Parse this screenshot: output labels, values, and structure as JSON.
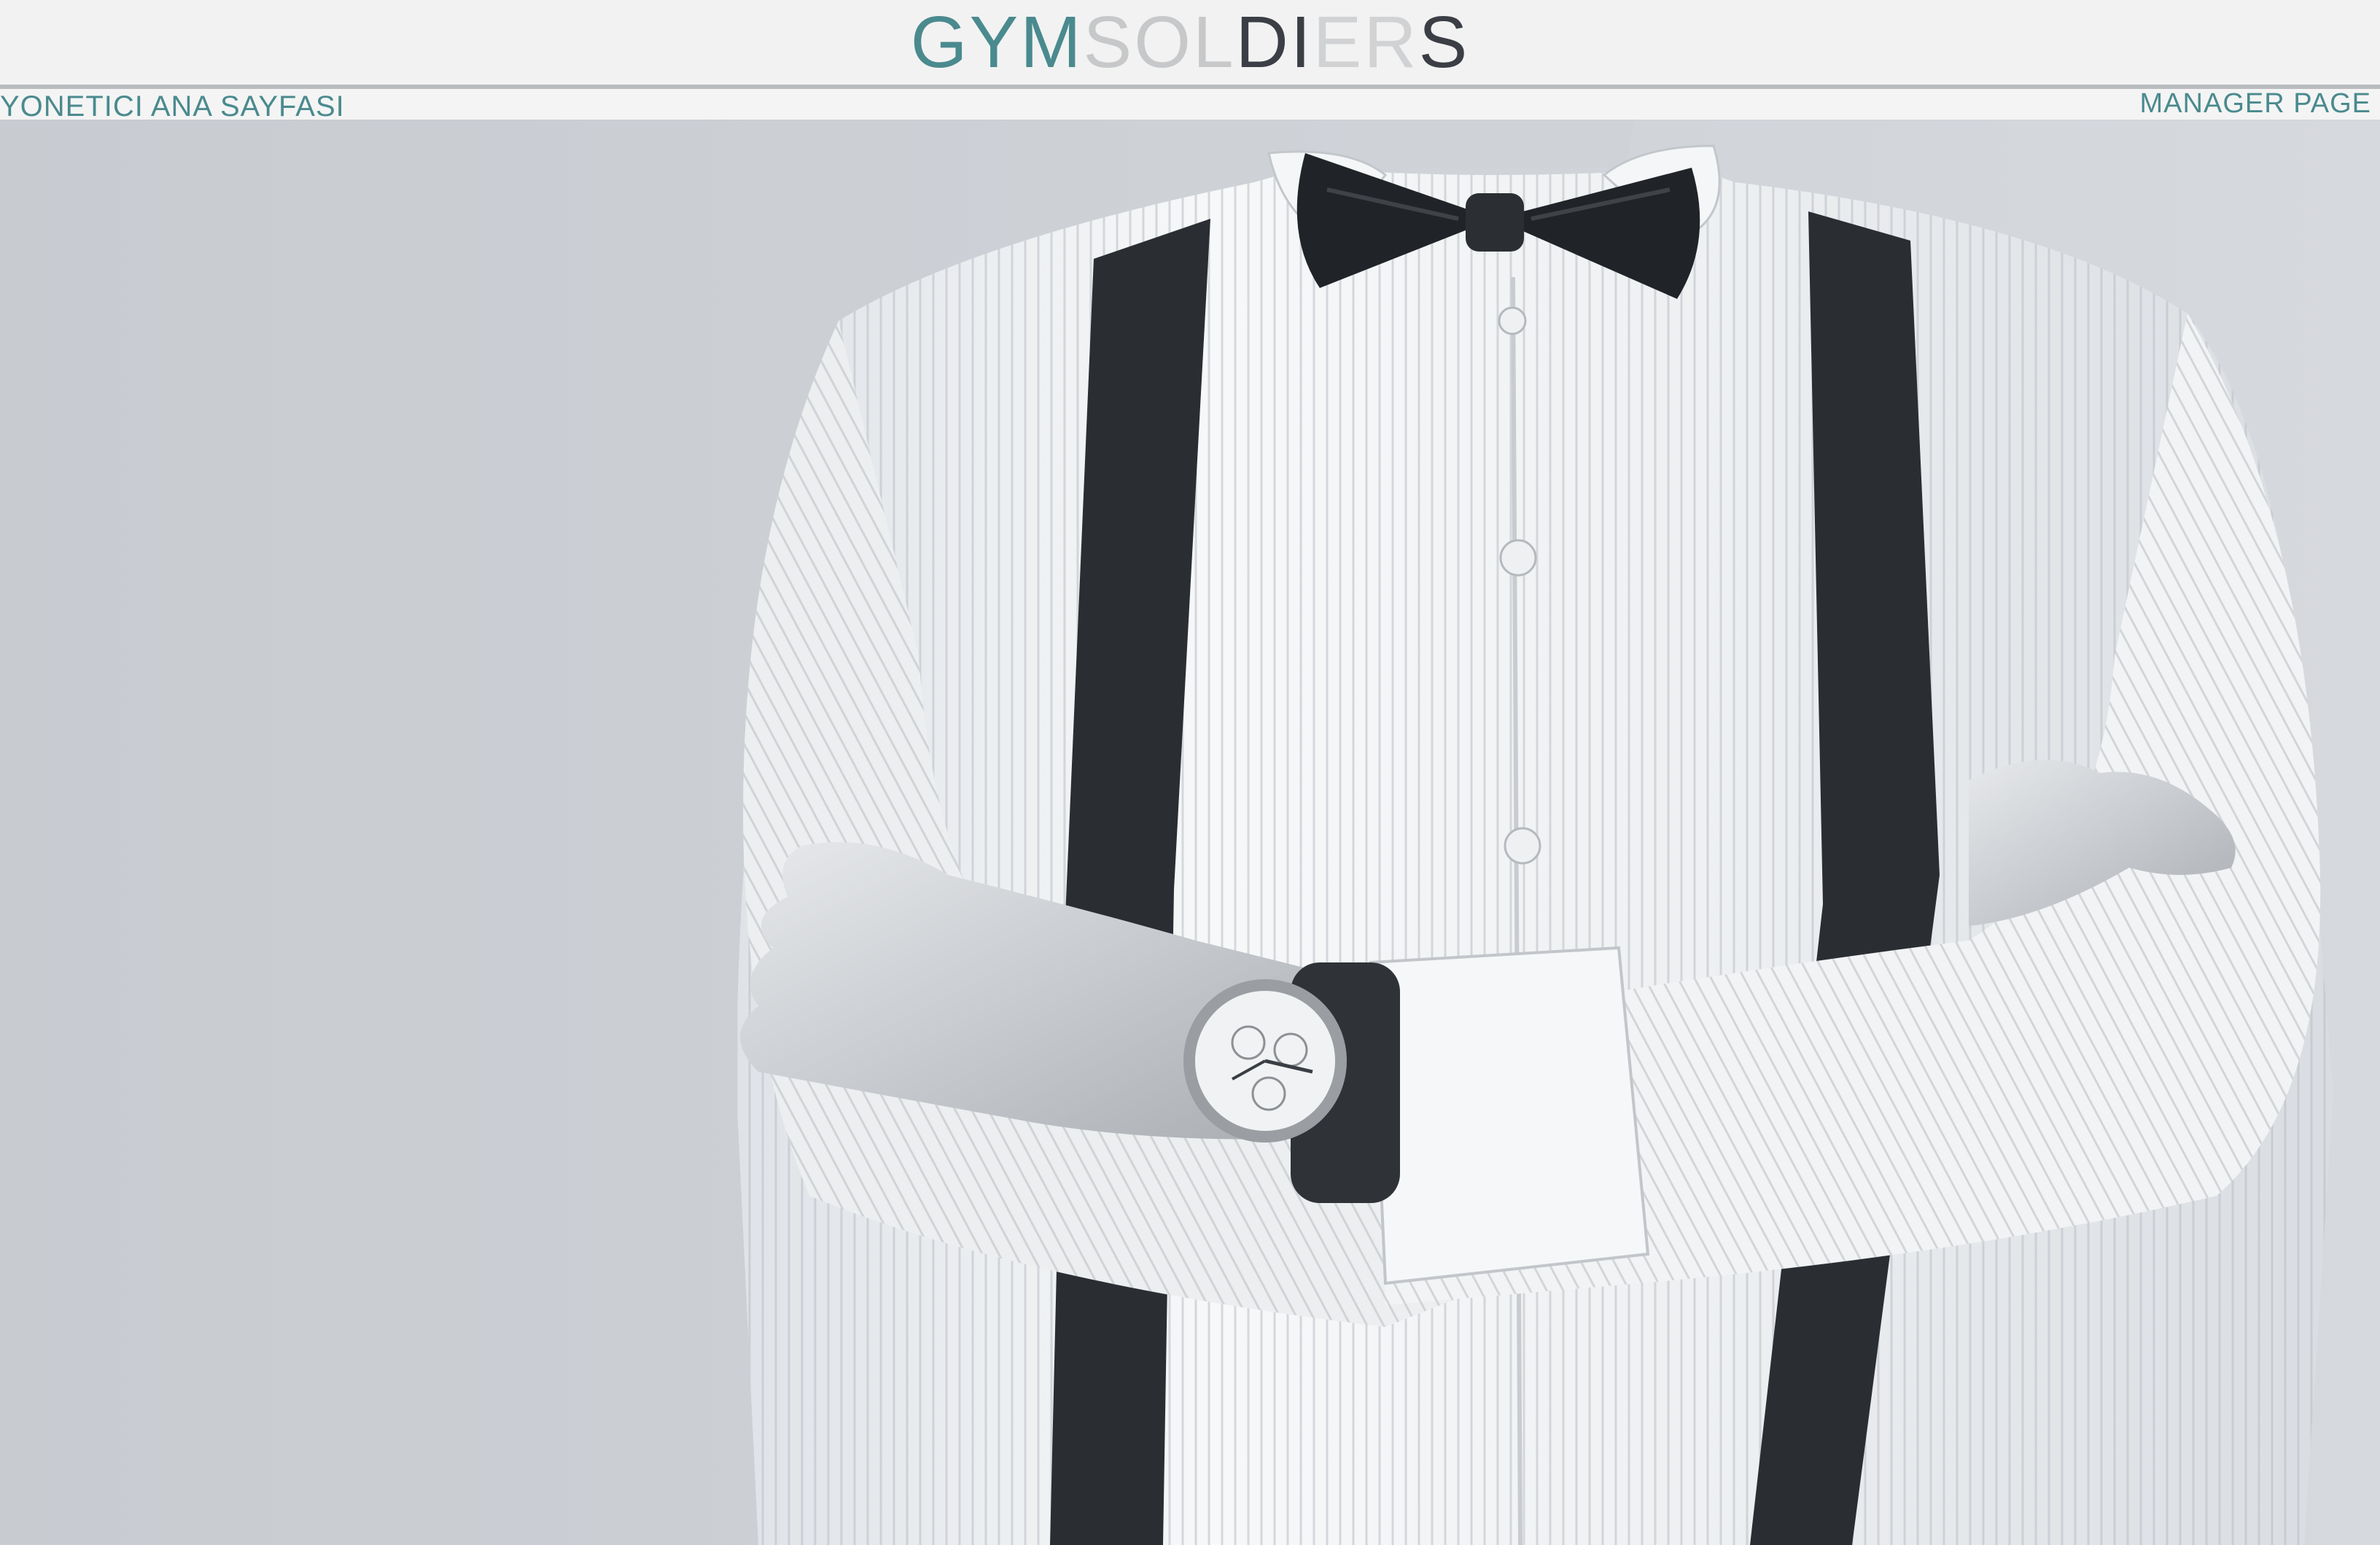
{
  "header": {
    "logo": {
      "part_gym": "GYM",
      "part_sol": "SOL",
      "part_di": "DI",
      "part_er": "ER",
      "part_s": "S"
    },
    "left_link": "YONETICI ANA SAYFASI",
    "right_link": "MANAGER PAGE"
  },
  "hero": {
    "image_subject": "man-in-white-shirt-bow-tie-suspenders-wristwatch"
  },
  "colors": {
    "accent": "#4a8a8e",
    "header_bg": "#f2f2f2",
    "page_bg": "#c9cdd2"
  }
}
